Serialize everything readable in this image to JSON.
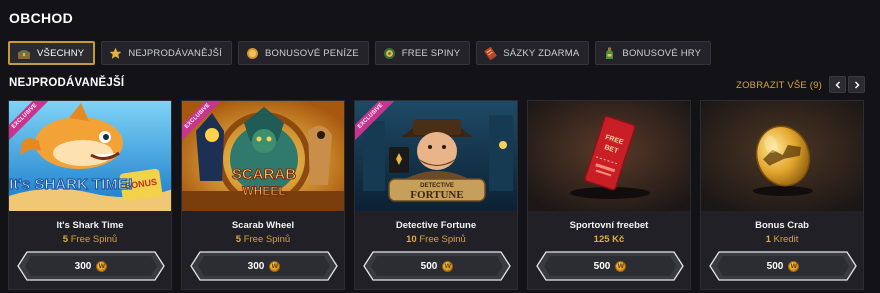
{
  "page": {
    "title": "OBCHOD"
  },
  "tabs": [
    {
      "label": "VŠECHNY",
      "icon": "chest-icon",
      "active": true
    },
    {
      "label": "NEJPRODÁVANĚJŠÍ",
      "icon": "star-icon",
      "active": false
    },
    {
      "label": "BONUSOVÉ PENÍZE",
      "icon": "coin-icon",
      "active": false
    },
    {
      "label": "FREE SPINY",
      "icon": "spin-icon",
      "active": false
    },
    {
      "label": "SÁZKY ZDARMA",
      "icon": "ticket-icon",
      "active": false
    },
    {
      "label": "BONUSOVÉ HRY",
      "icon": "bottle-icon",
      "active": false
    }
  ],
  "section": {
    "title": "NEJPRODÁVANĚJŠÍ",
    "view_all": "ZOBRAZIT VŠE (9)",
    "prev_icon": "chevron-left-icon",
    "next_icon": "chevron-right-icon"
  },
  "cards": [
    {
      "name": "It's Shark Time",
      "ribbon": "EXCLUSIVE",
      "reward_amount": "5",
      "reward_unit": "Free Spinů",
      "price": "300",
      "art": "It's SHARK TIME! BONUS",
      "accent": "#2aa8e8"
    },
    {
      "name": "Scarab Wheel",
      "ribbon": "EXCLUSIVE",
      "reward_amount": "5",
      "reward_unit": "Free Spinů",
      "price": "300",
      "art": "SCARAB WHEEL",
      "accent": "#d79a1f"
    },
    {
      "name": "Detective Fortune",
      "ribbon": "EXCLUSIVE",
      "reward_amount": "10",
      "reward_unit": "Free Spinů",
      "price": "500",
      "art": "DETECTIVE FORTUNE",
      "accent": "#2c5f7a"
    },
    {
      "name": "Sportovní freebet",
      "ribbon": "",
      "reward_amount": "125 Kč",
      "reward_unit": "",
      "price": "500",
      "art": "FREE BET",
      "accent": "#c4202a"
    },
    {
      "name": "Bonus Crab",
      "ribbon": "",
      "reward_amount": "1",
      "reward_unit": "Kredit",
      "price": "500",
      "art": "",
      "accent": "#e0a82c"
    }
  ],
  "coin_symbol": "W",
  "colors": {
    "gold": "#d9a63d",
    "active_border": "#c89a35",
    "ribbon": "#c8358f",
    "background": "#131317"
  }
}
